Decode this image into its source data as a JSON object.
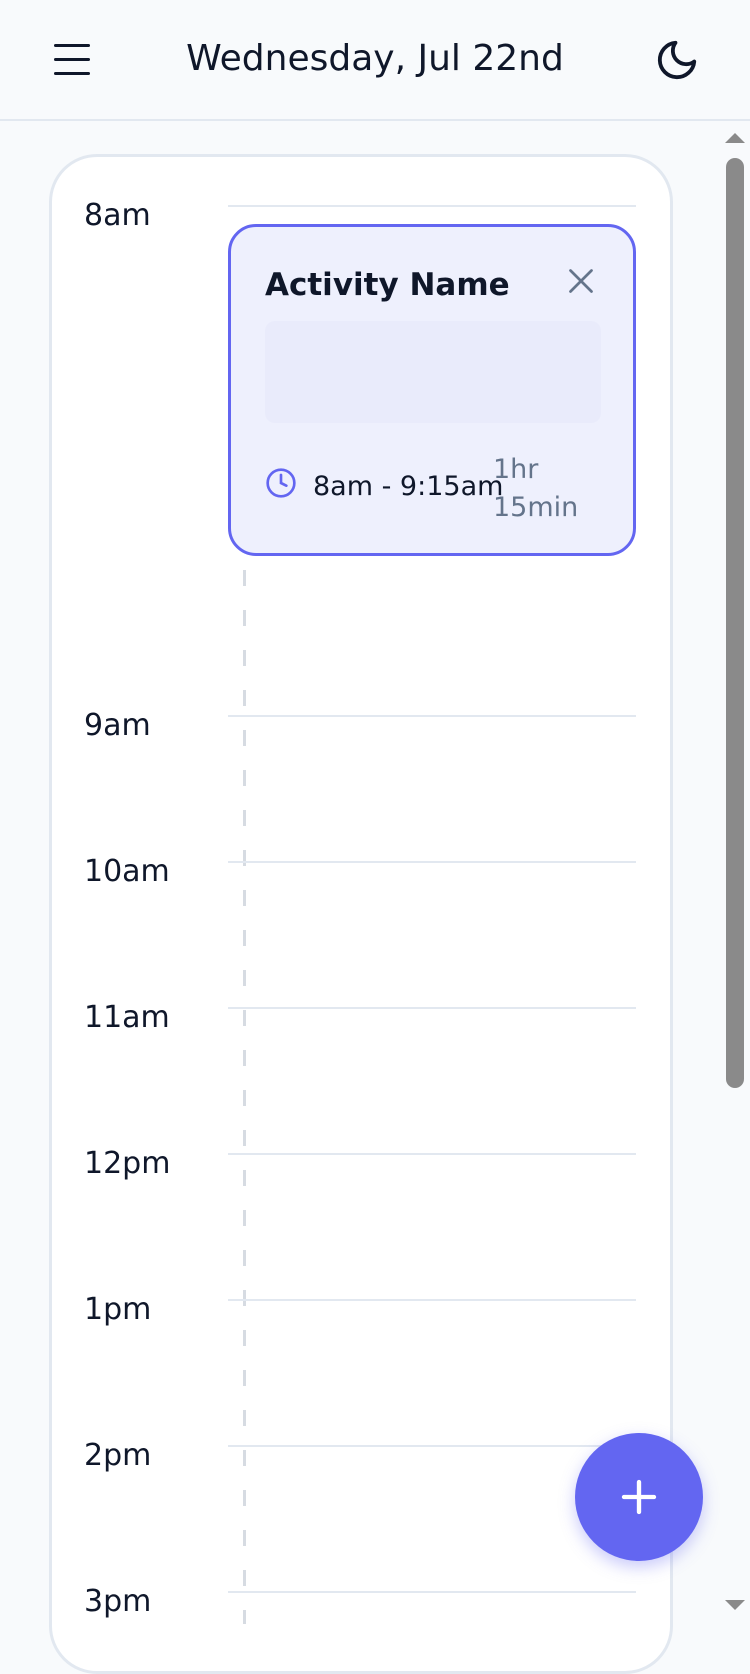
{
  "header": {
    "title": "Wednesday, Jul 22nd",
    "menu_icon": "hamburger-menu-icon",
    "theme_icon": "moon-icon"
  },
  "timeline": {
    "hours": [
      "8am",
      "9am",
      "10am",
      "11am",
      "12pm",
      "1pm",
      "2pm",
      "3pm"
    ]
  },
  "event": {
    "name": "Activity Name",
    "time_range": "8am - 9:15am",
    "duration_line1": "1hr",
    "duration_line2": "15min",
    "icons": {
      "close": "close-icon",
      "clock": "clock-icon"
    }
  },
  "fab": {
    "icon": "plus-icon"
  },
  "colors": {
    "accent": "#6366f1",
    "event_bg": "#eef0fd",
    "text": "#0f172a",
    "muted": "#64748b",
    "border": "#e2e8f0"
  }
}
